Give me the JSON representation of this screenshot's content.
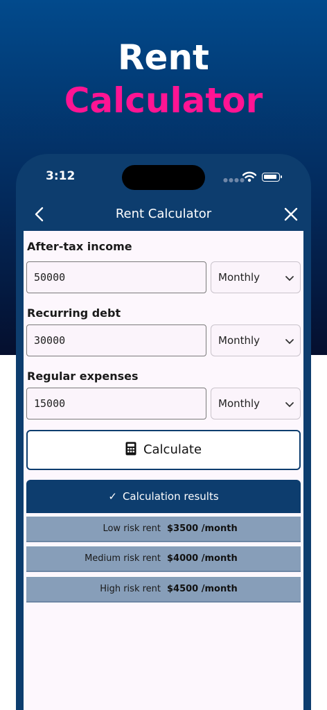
{
  "headline": {
    "line1": "Rent",
    "line2": "Calculator"
  },
  "status_bar": {
    "time": "3:12"
  },
  "nav": {
    "title": "Rent Calculator"
  },
  "form": {
    "income": {
      "label": "After-tax income",
      "value": "50000",
      "period": "Monthly"
    },
    "debt": {
      "label": "Recurring debt",
      "value": "30000",
      "period": "Monthly"
    },
    "expenses": {
      "label": "Regular expenses",
      "value": "15000",
      "period": "Monthly"
    }
  },
  "calculate_button": {
    "label": "Calculate"
  },
  "results": {
    "header": "Calculation results",
    "rows": [
      {
        "label": "Low risk rent",
        "value": "$3500 /month"
      },
      {
        "label": "Medium risk rent",
        "value": "$4000 /month"
      },
      {
        "label": "High risk rent",
        "value": "$4500 /month"
      }
    ]
  },
  "colors": {
    "primary": "#0d3d6e",
    "accent": "#ff1493",
    "result_row": "#879eb9"
  }
}
